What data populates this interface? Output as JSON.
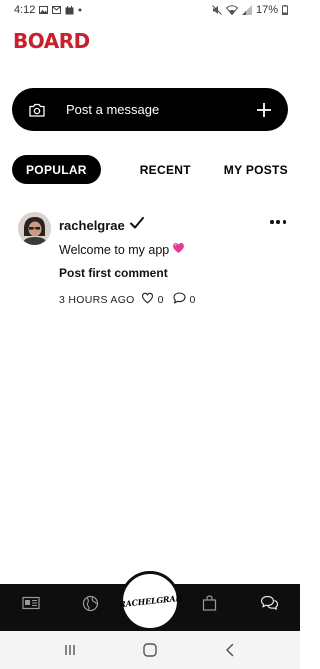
{
  "status_bar": {
    "time": "4:12",
    "battery": "17%"
  },
  "header": {
    "brand": "BOARD"
  },
  "composer": {
    "placeholder": "Post a message",
    "camera_icon": "camera-icon",
    "add_icon": "plus-icon"
  },
  "tabs": [
    {
      "label": "POPULAR",
      "active": true
    },
    {
      "label": "RECENT",
      "active": false
    },
    {
      "label": "MY POSTS",
      "active": false
    }
  ],
  "post": {
    "author": "rachelgrae",
    "verified": true,
    "message": "Welcome to my app",
    "emoji": "heart",
    "action": "Post first comment",
    "time": "3 HOURS AGO",
    "likes": "0",
    "comments": "0"
  },
  "bottom_nav": {
    "items": [
      "news-icon",
      "globe-icon",
      "home-logo",
      "shopping-bag-icon",
      "chat-icon"
    ],
    "center_logo": "RACHELGRAE"
  },
  "colors": {
    "brand": "#c8202f",
    "dark": "#000000",
    "nav_bg": "#0e0e0e",
    "heart": "#e8399a"
  }
}
